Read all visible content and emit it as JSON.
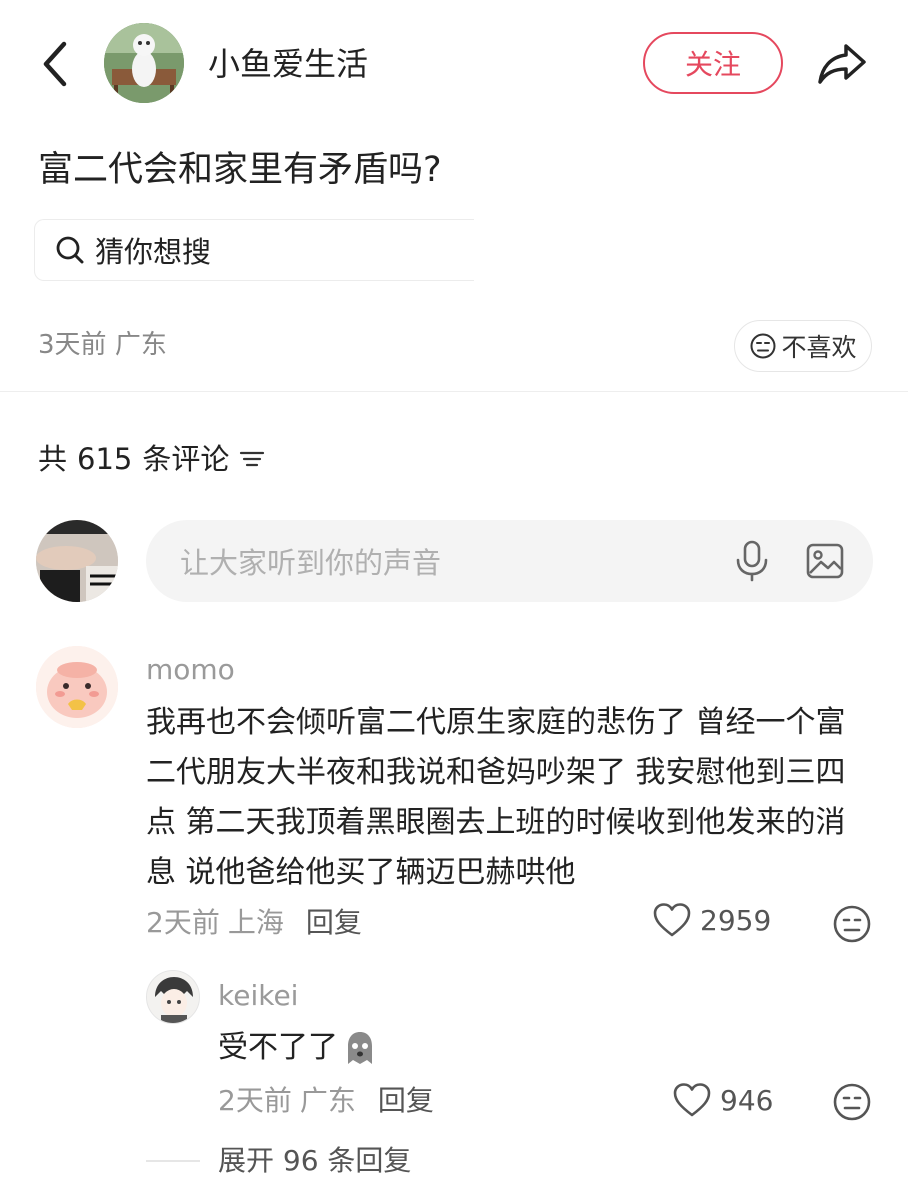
{
  "header": {
    "author_name": "小鱼爱生活",
    "follow_label": "关注"
  },
  "post": {
    "title": "富二代会和家里有矛盾吗?",
    "search_chip": "猜你想搜",
    "time": "3天前",
    "location": "广东",
    "dislike_label": "不喜欢"
  },
  "comments_section": {
    "count_prefix": "共",
    "count": "615",
    "count_suffix": "条评论",
    "input_placeholder": "让大家听到你的声音"
  },
  "comment": {
    "user": "momo",
    "text": "我再也不会倾听富二代原生家庭的悲伤了 曾经一个富二代朋友大半夜和我说和爸妈吵架了 我安慰他到三四点 第二天我顶着黑眼圈去上班的时候收到他发来的消息 说他爸给他买了辆迈巴赫哄他",
    "time": "2天前",
    "location": "上海",
    "reply_label": "回复",
    "likes": "2959"
  },
  "reply": {
    "user": "keikei",
    "text": "受不了了",
    "time": "2天前",
    "location": "广东",
    "reply_label": "回复",
    "likes": "946"
  },
  "expand_label": "展开 96 条回复",
  "colors": {
    "accent": "#e5485e",
    "muted_text": "#999999",
    "input_bg": "#f4f4f4"
  },
  "icons": [
    "back-arrow-icon",
    "share-icon",
    "search-icon",
    "neutral-face-icon",
    "sort-icon",
    "microphone-icon",
    "image-icon",
    "heart-icon",
    "ghost-emoji-icon"
  ]
}
